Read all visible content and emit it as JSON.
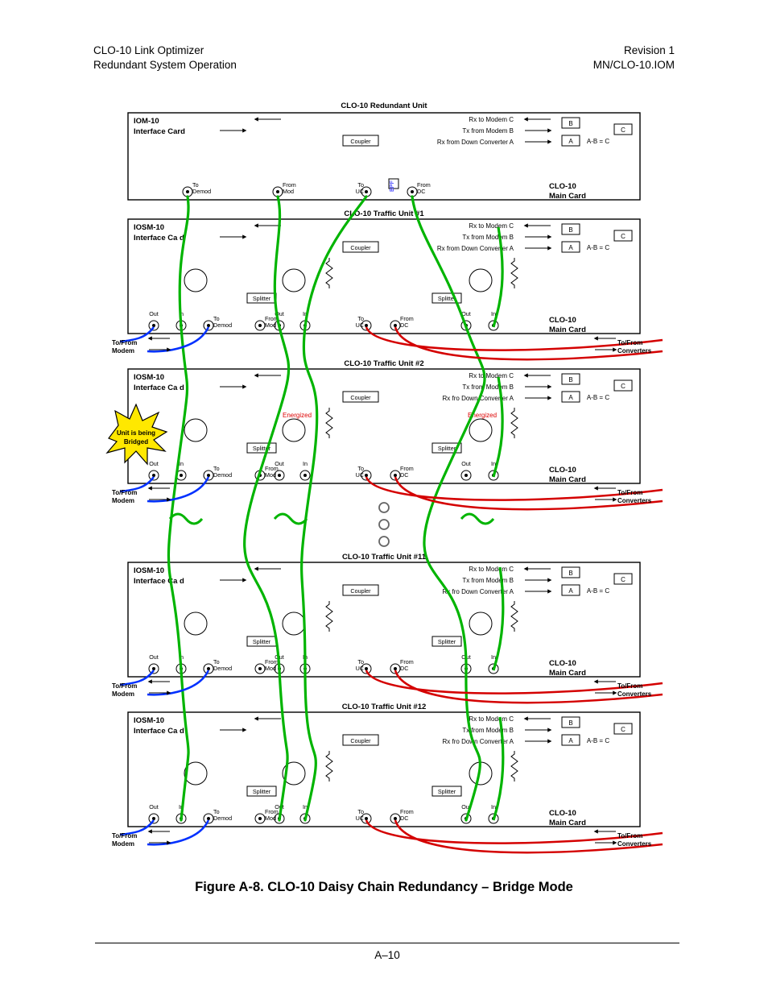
{
  "header": {
    "left1": "CLO-10 Link Optimizer",
    "left2": "Redundant System Operation",
    "right1": "Revision 1",
    "right2": "MN/CLO-10.IOM"
  },
  "caption": "Figure A-8. CLO-10 Daisy Chain Redundancy – Bridge Mode",
  "page_number": "A–10",
  "diagram": {
    "top_title": "CLO-10 Redundant Unit",
    "traffic_titles": [
      "CLO-10 Traffic Unit #1",
      "CLO-10 Traffic Unit #2",
      "CLO-10 Traffic Unit #11",
      "CLO-10 Traffic Unit #12"
    ],
    "iom_label": "IOM-10",
    "iosm_label": "IOSM-10",
    "interface_label": "Interface Card",
    "interface_label_gap": "Interface Ca    d",
    "main_card_top": "CLO-10",
    "main_card_bottom": "Main Card",
    "coupler": "Coupler",
    "splitter": "Splitter",
    "rx_c": "Rx to Modem C",
    "tx_b": "Tx from Modem B",
    "rx_a": "Rx from Down Converter A",
    "rx_a_gap": "Rx from   Down Converter A",
    "rx_a_gap2": "Rx fro      Down Converter A",
    "tx_b_gap": "Tx from Modem B",
    "a": "A",
    "b": "B",
    "c": "C",
    "eq": "A-B = C",
    "to_demod": "To\nDemod",
    "from_mod": "From\nMod",
    "to_uc": "To\nUC",
    "from_dc": "From\nDC",
    "out": "Out",
    "in": "In",
    "tofrom_modem": "To/From\nModem",
    "tofrom_conv": "To/From\nConverters",
    "energized": "Energized",
    "burst": "Unit is being\nBridged"
  }
}
